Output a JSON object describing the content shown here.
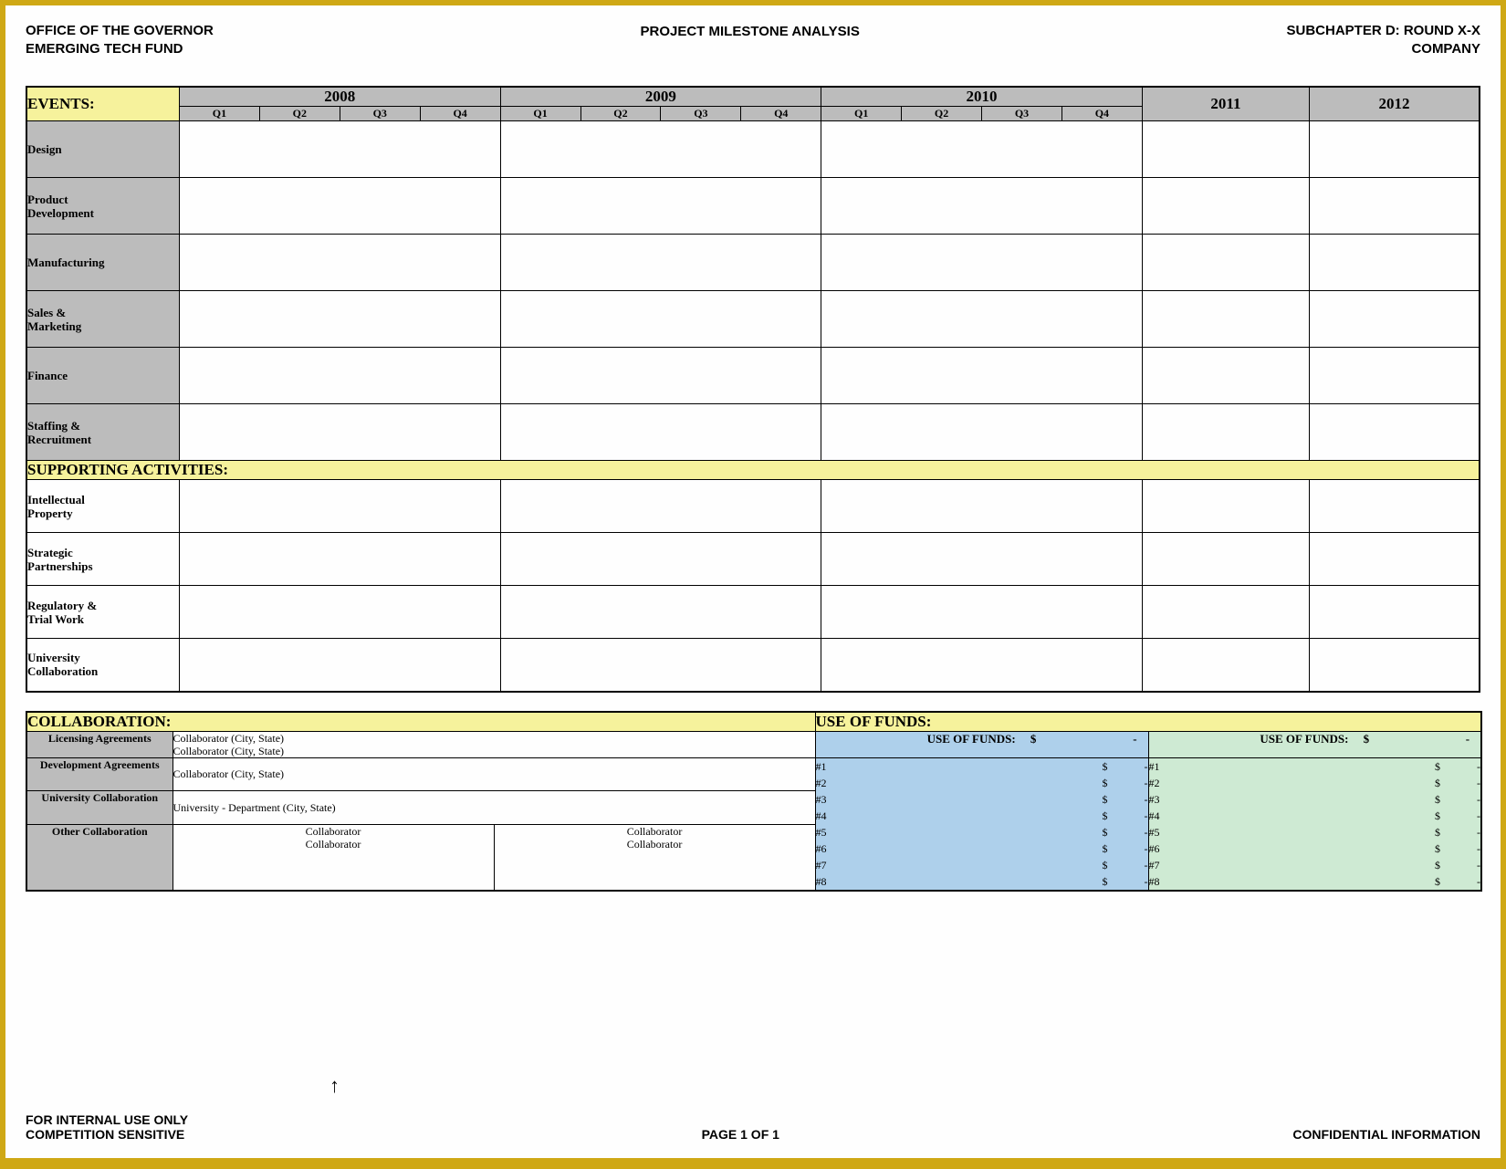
{
  "header": {
    "left_line1": "OFFICE OF THE GOVERNOR",
    "left_line2": "EMERGING TECH FUND",
    "center": "PROJECT MILESTONE ANALYSIS",
    "right_line1": "SUBCHAPTER D: ROUND X-X",
    "right_line2": "COMPANY"
  },
  "events": {
    "title": "EVENTS:",
    "years": [
      "2008",
      "2009",
      "2010",
      "2011",
      "2012"
    ],
    "quarters": [
      "Q1",
      "Q2",
      "Q3",
      "Q4"
    ],
    "rows": [
      "Design",
      "Product Development",
      "Manufacturing",
      "Sales & Marketing",
      "Finance",
      "Staffing & Recruitment"
    ]
  },
  "supporting": {
    "title": "SUPPORTING ACTIVITIES:",
    "rows": [
      "Intellectual Property",
      "Strategic Partnerships",
      "Regulatory & Trial Work",
      "University Collaboration"
    ]
  },
  "collab": {
    "title": "COLLABORATION:",
    "items": [
      {
        "label": "Licensing Agreements",
        "value": "Collaborator (City, State)\nCollaborator (City, State)"
      },
      {
        "label": "Development Agreements",
        "value": "Collaborator (City, State)"
      },
      {
        "label": "University Collaboration",
        "value": "University - Department (City, State)"
      },
      {
        "label": "Other Collaboration",
        "value_a1": "Collaborator",
        "value_a2": "Collaborator",
        "value_b1": "Collaborator",
        "value_b2": "Collaborator"
      }
    ]
  },
  "funds": {
    "title": "USE OF FUNDS:",
    "col_label": "USE OF FUNDS:",
    "dollar": "$",
    "dash": "-",
    "labels": [
      "#1",
      "#2",
      "#3",
      "#4",
      "#5",
      "#6",
      "#7",
      "#8"
    ]
  },
  "footer": {
    "left_line1": "FOR INTERNAL USE ONLY",
    "left_line2": "COMPETITION SENSITIVE",
    "center": "PAGE 1 OF 1",
    "right": "CONFIDENTIAL INFORMATION"
  }
}
